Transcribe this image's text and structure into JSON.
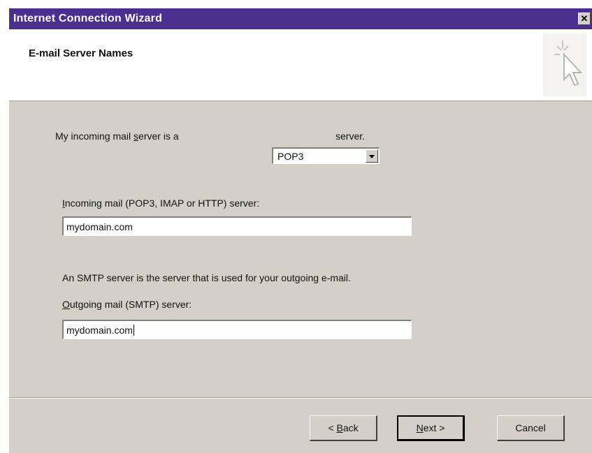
{
  "window": {
    "title": "Internet Connection Wizard",
    "close_label": "✕"
  },
  "header": {
    "heading": "E-mail Server Names",
    "graphic_icon": "wizard-sparkle-cursor"
  },
  "server_type": {
    "prefix_before_key": "My incoming mail ",
    "prefix_key": "s",
    "prefix_after_key": "erver is a",
    "selected": "POP3",
    "suffix": "server."
  },
  "incoming": {
    "label_key": "I",
    "label_rest": "ncoming mail (POP3, IMAP or HTTP) server:",
    "value": "mydomain.com"
  },
  "smtp_info": "An SMTP server is the server that is used for your outgoing e-mail.",
  "outgoing": {
    "label_key": "O",
    "label_rest": "utgoing mail (SMTP) server:",
    "value": "mydomain.com"
  },
  "buttons": {
    "back_prefix": "< ",
    "back_key": "B",
    "back_rest": "ack",
    "next_key": "N",
    "next_rest": "ext >",
    "cancel": "Cancel"
  },
  "colors": {
    "titlebar": "#4b2f8e",
    "dialog_face": "#d4d0c8"
  }
}
